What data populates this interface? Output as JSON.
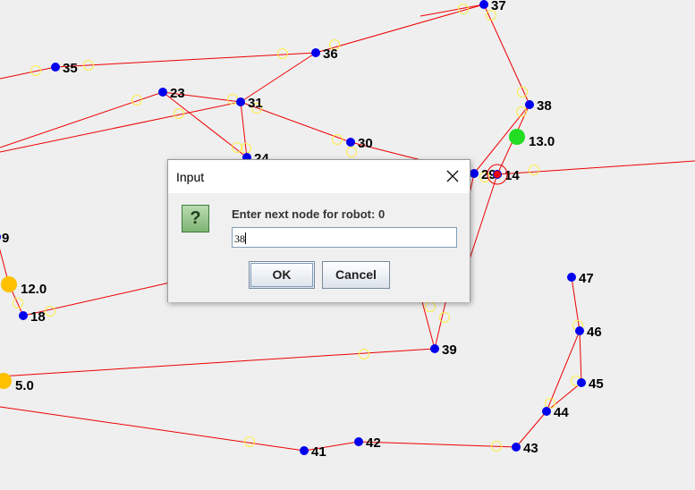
{
  "graph": {
    "nodes": [
      {
        "id": "37",
        "label": "37"
      },
      {
        "id": "35",
        "label": "35"
      },
      {
        "id": "36",
        "label": "36"
      },
      {
        "id": "23",
        "label": "23"
      },
      {
        "id": "31",
        "label": "31"
      },
      {
        "id": "38",
        "label": "38"
      },
      {
        "id": "30",
        "label": "30"
      },
      {
        "id": "24",
        "label": "24"
      },
      {
        "id": "29",
        "label": "29"
      },
      {
        "id": "14",
        "label": "14"
      },
      {
        "id": "9",
        "label": "9"
      },
      {
        "id": "18",
        "label": "18"
      },
      {
        "id": "47",
        "label": "47"
      },
      {
        "id": "46",
        "label": "46"
      },
      {
        "id": "39",
        "label": "39"
      },
      {
        "id": "45",
        "label": "45"
      },
      {
        "id": "44",
        "label": "44"
      },
      {
        "id": "41",
        "label": "41"
      },
      {
        "id": "42",
        "label": "42"
      },
      {
        "id": "43",
        "label": "43"
      }
    ],
    "robots": [
      {
        "label": "13.0",
        "color": "#22dd22"
      },
      {
        "label": "12.0",
        "color": "#ffc000"
      },
      {
        "label": "5.0",
        "color": "#ffc000"
      }
    ],
    "colors": {
      "node": "#0000ee",
      "edge": "#ee0000",
      "waypoint": "#ffee44",
      "robot_current": "#ee0000"
    }
  },
  "dialog": {
    "title": "Input",
    "prompt": "Enter next node for robot: 0",
    "input_value": "38",
    "ok_label": "OK",
    "cancel_label": "Cancel",
    "icon": "question-icon",
    "close_icon": "close-icon"
  }
}
